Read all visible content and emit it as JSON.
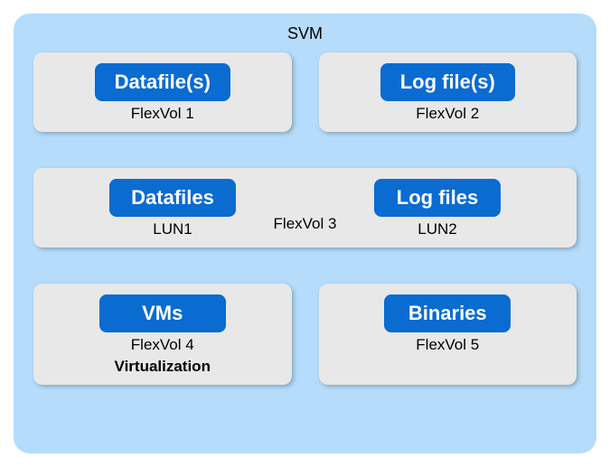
{
  "svm": {
    "title": "SVM",
    "row1": {
      "left": {
        "label": "Datafile(s)",
        "sub": "FlexVol 1"
      },
      "right": {
        "label": "Log file(s)",
        "sub": "FlexVol 2"
      }
    },
    "row2": {
      "left": {
        "label": "Datafiles",
        "sub": "LUN1"
      },
      "right": {
        "label": "Log files",
        "sub": "LUN2"
      },
      "center": "FlexVol 3"
    },
    "row3": {
      "left": {
        "label": "VMs",
        "sub": "FlexVol 4",
        "sub2": "Virtualization"
      },
      "right": {
        "label": "Binaries",
        "sub": "FlexVol 5"
      }
    }
  }
}
